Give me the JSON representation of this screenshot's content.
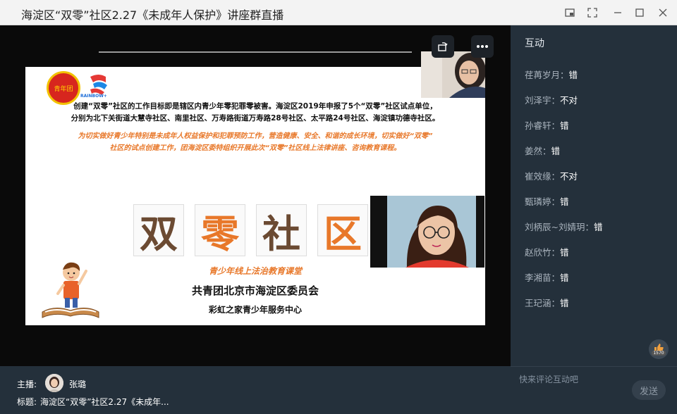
{
  "window": {
    "title": "海淀区“双零”社区2.27《未成年人保护》讲座群直播"
  },
  "slide": {
    "logo_text": "青年团",
    "logo2_text": "RAINBOW+",
    "paragraph1_line1": "创建“双零”社区的工作目标即是辖区内青少年零犯罪零被害。海淀区2019年申报了5个“双零”社区试点单位，",
    "paragraph1_line2": "分别为北下关街道大慧寺社区、南里社区、万寿路街道万寿路28号社区、太平路24号社区、海淀镇功德寺社区。",
    "paragraph2_line1": "为切实做好青少年特别是未成年人权益保护和犯罪预防工作，营造健康、安全、和谐的成长环境，切实做好“双零”",
    "paragraph2_line2": "社区的试点创建工作，团海淀区委特组织开展此次“双零”社区线上法律讲座、咨询教育课程。",
    "big_chars": [
      "双",
      "零",
      "社",
      "区"
    ],
    "subtitle": "青少年线上法治教育课堂",
    "org1": "共青团北京市海淀区委员会",
    "org2": "彩虹之家青少年服务中心"
  },
  "side": {
    "header": "互动",
    "comments": [
      {
        "name": "荏苒岁月",
        "text": "错"
      },
      {
        "name": "刘泽宇",
        "text": "不对"
      },
      {
        "name": "孙睿轩",
        "text": "错"
      },
      {
        "name": "姜然",
        "text": "错"
      },
      {
        "name": "崔效缘",
        "text": "不对"
      },
      {
        "name": "甄璘婷",
        "text": "错"
      },
      {
        "name": "刘柄辰~刘婧玥",
        "text": "错"
      },
      {
        "name": "赵欣竹",
        "text": "错"
      },
      {
        "name": "李湘苗",
        "text": "错"
      },
      {
        "name": "王玘涵",
        "text": "错"
      }
    ],
    "like_count": "1570",
    "comment_placeholder": "快来评论互动吧",
    "send_label": "发送"
  },
  "bottom": {
    "host_label": "主播:",
    "host_name": "张璐",
    "title_label": "标题:",
    "title_value": "海淀区“双零”社区2.27《未成年..."
  },
  "colors": {
    "accent_orange": "#e8782a",
    "char_brown": "#6b4a32",
    "panel_bg": "#24303b"
  }
}
